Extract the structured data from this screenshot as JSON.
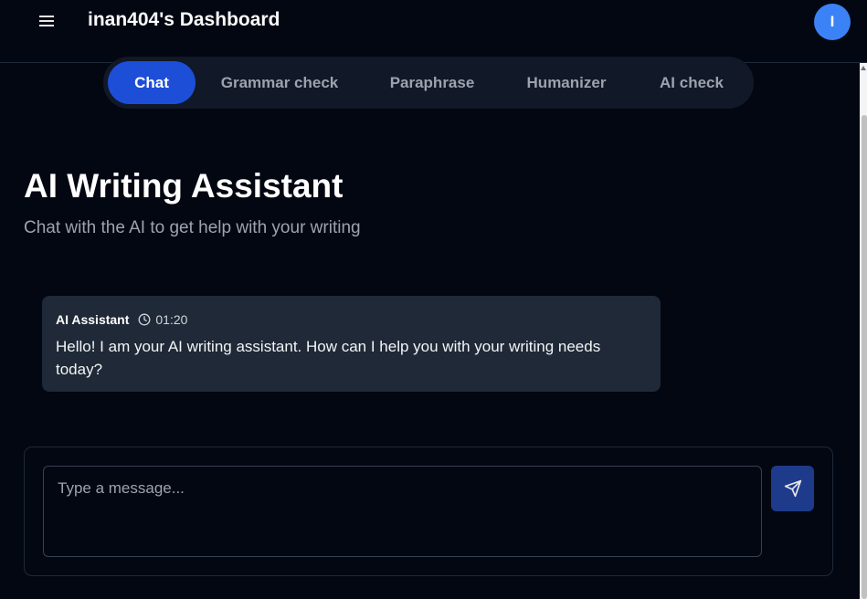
{
  "header": {
    "title": "inan404's Dashboard",
    "avatar_initial": "I",
    "menu_icon": "hamburger-menu-icon"
  },
  "tabs": [
    {
      "label": "Chat",
      "active": true
    },
    {
      "label": "Grammar check",
      "active": false
    },
    {
      "label": "Paraphrase",
      "active": false
    },
    {
      "label": "Humanizer",
      "active": false
    },
    {
      "label": "AI check",
      "active": false
    }
  ],
  "main": {
    "title": "AI Writing Assistant",
    "subtitle": "Chat with the AI to get help with your writing"
  },
  "messages": [
    {
      "sender": "AI Assistant",
      "time": "01:20",
      "text": "Hello! I am your AI writing assistant. How can I help you with your writing needs today?"
    }
  ],
  "composer": {
    "placeholder": "Type a message...",
    "value": "",
    "send_icon": "send-icon"
  },
  "colors": {
    "background": "#030712",
    "accent": "#1d4ed8",
    "avatar": "#3b82f6",
    "bubble": "#1f2937",
    "send_button": "#1e3a8a"
  }
}
